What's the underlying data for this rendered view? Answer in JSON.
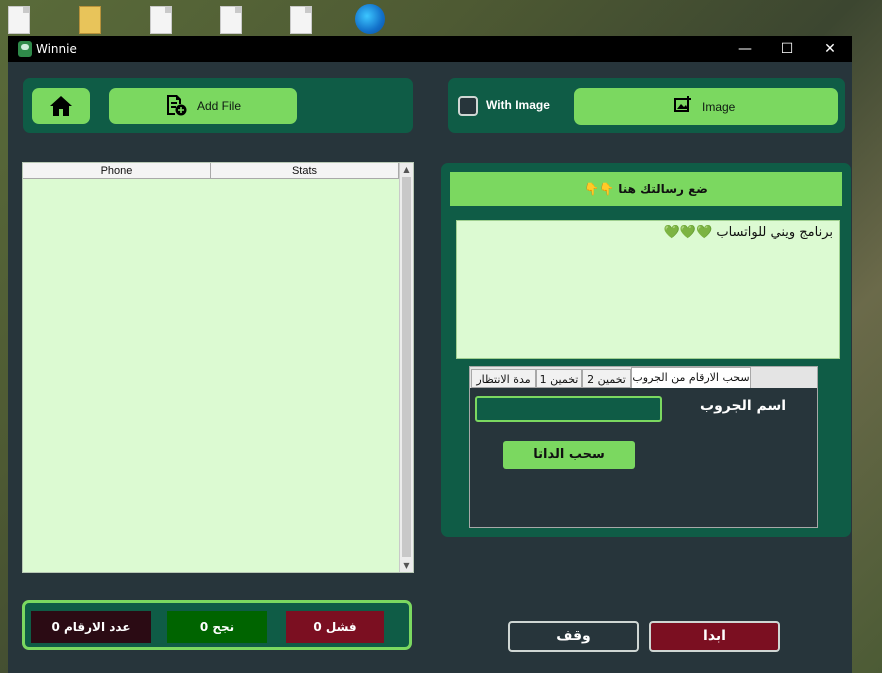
{
  "window": {
    "title": "Winnie",
    "minimize": "—",
    "maximize": "☐",
    "close": "✕"
  },
  "toolbar": {
    "add_file_label": "Add File",
    "with_image_label": "With Image",
    "image_label": "Image"
  },
  "numbers_table": {
    "columns": [
      "Phone",
      "Stats"
    ]
  },
  "stats": {
    "count_label": "عدد الارقام 0",
    "success_label": "نجح 0",
    "fail_label": "فشل 0"
  },
  "message": {
    "header": "ضع رسالتك هنا",
    "header_emoji": "👇👇",
    "body_text": "برنامج ويني للواتساب",
    "hearts": "💚💚💚"
  },
  "tabs": [
    "سحب الارقام من الجروب",
    "تخمين 2",
    "تخمين 1",
    "مدة الانتظار"
  ],
  "groups_tab": {
    "group_name_label": "اسم الجروب",
    "pull_button": "سحب الداتا"
  },
  "actions": {
    "stop_label": "وقف",
    "start_label": "ابدا"
  },
  "colors": {
    "panel": "#0f5c46",
    "accent_green": "#7bd860",
    "window_bg": "#27353b",
    "fail_red": "#7b0f21",
    "count_bg": "#2b0b14",
    "success_green": "#006400"
  }
}
